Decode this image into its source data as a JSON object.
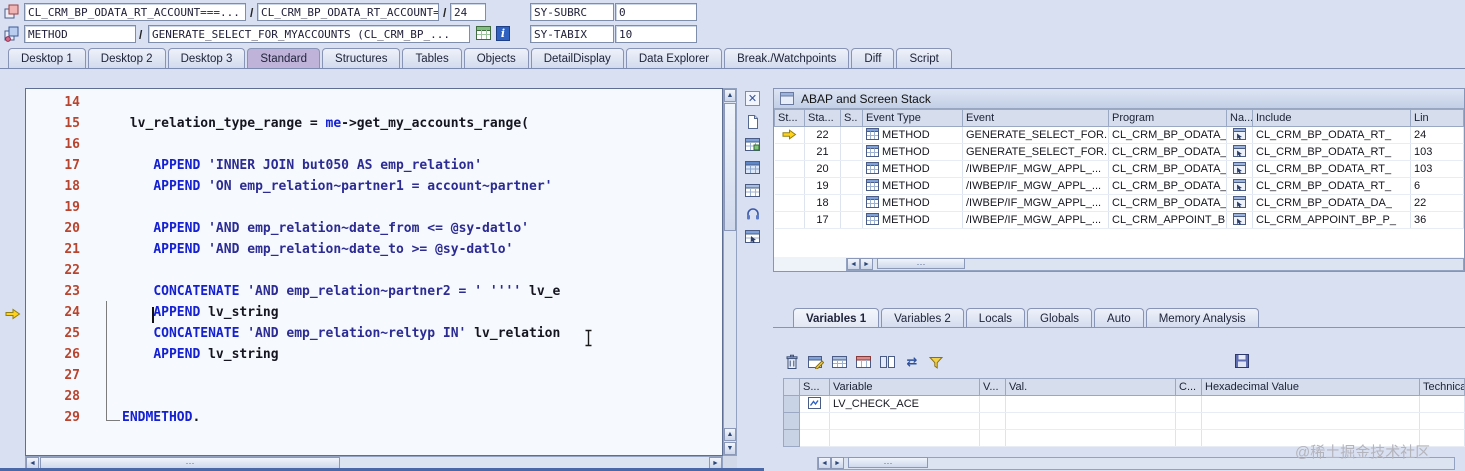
{
  "topbar": {
    "row1": {
      "class_field_1": "CL_CRM_BP_ODATA_RT_ACCOUNT===...",
      "separator": "/",
      "class_field_2": "CL_CRM_BP_ODATA_RT_ACCOUNT===...",
      "line_field": "24",
      "sy_subrc_label": "SY-SUBRC",
      "sy_subrc_value": "0"
    },
    "row2": {
      "event_type_field": "METHOD",
      "separator": "/",
      "event_field": "GENERATE_SELECT_FOR_MYACCOUNTS (CL_CRM_BP_...",
      "sy_tabix_label": "SY-TABIX",
      "sy_tabix_value": "10"
    }
  },
  "desktop_tabs": {
    "items": [
      "Desktop 1",
      "Desktop 2",
      "Desktop 3",
      "Standard",
      "Structures",
      "Tables",
      "Objects",
      "DetailDisplay",
      "Data Explorer",
      "Break./Watchpoints",
      "Diff",
      "Script"
    ],
    "active": "Standard"
  },
  "editor": {
    "current_line": "24",
    "lines": [
      {
        "n": "14",
        "t": []
      },
      {
        "n": "15",
        "t": [
          [
            "w",
            " "
          ],
          [
            "p",
            "lv_relation_type_range = "
          ],
          [
            "k",
            "me"
          ],
          [
            "p",
            "->get_my_accounts_range("
          ]
        ]
      },
      {
        "n": "16",
        "t": []
      },
      {
        "n": "17",
        "t": [
          [
            "w",
            "    "
          ],
          [
            "k",
            "APPEND"
          ],
          [
            "p",
            " "
          ],
          [
            "s",
            "'INNER JOIN but050 AS emp_relation'"
          ]
        ]
      },
      {
        "n": "18",
        "t": [
          [
            "w",
            "    "
          ],
          [
            "k",
            "APPEND"
          ],
          [
            "p",
            " "
          ],
          [
            "s",
            "'ON emp_relation~partner1 = account~partner'"
          ]
        ]
      },
      {
        "n": "19",
        "t": []
      },
      {
        "n": "20",
        "t": [
          [
            "w",
            "    "
          ],
          [
            "k",
            "APPEND"
          ],
          [
            "p",
            " "
          ],
          [
            "s",
            "'AND emp_relation~date_from <= @sy-datlo'"
          ]
        ]
      },
      {
        "n": "21",
        "t": [
          [
            "w",
            "    "
          ],
          [
            "k",
            "APPEND"
          ],
          [
            "p",
            " "
          ],
          [
            "s",
            "'AND emp_relation~date_to >= @sy-datlo'"
          ]
        ]
      },
      {
        "n": "22",
        "t": []
      },
      {
        "n": "23",
        "t": [
          [
            "w",
            "    "
          ],
          [
            "k",
            "CONCATENATE"
          ],
          [
            "p",
            " "
          ],
          [
            "s",
            "'AND emp_relation~partner2 = '"
          ],
          [
            "p",
            " "
          ],
          [
            "s",
            "''''"
          ],
          [
            "p",
            " lv_e"
          ]
        ],
        "caret": false
      },
      {
        "n": "24",
        "t": [
          [
            "w",
            "    "
          ],
          [
            "k",
            "APPEND"
          ],
          [
            "p",
            " lv_string"
          ]
        ],
        "caret": true
      },
      {
        "n": "25",
        "t": [
          [
            "w",
            "    "
          ],
          [
            "k",
            "CONCATENATE"
          ],
          [
            "p",
            " "
          ],
          [
            "s",
            "'AND emp_relation~reltyp IN'"
          ],
          [
            "p",
            " lv_relation"
          ]
        ]
      },
      {
        "n": "26",
        "t": [
          [
            "w",
            "    "
          ],
          [
            "k",
            "APPEND"
          ],
          [
            "p",
            " lv_string"
          ]
        ]
      },
      {
        "n": "27",
        "t": []
      },
      {
        "n": "28",
        "t": []
      },
      {
        "n": "29",
        "t": [
          [
            "k",
            "ENDMETHOD"
          ],
          [
            "p",
            "."
          ]
        ]
      }
    ]
  },
  "stack": {
    "title": "ABAP and Screen Stack",
    "columns": [
      "St...",
      "Sta...",
      "S..",
      "Event Type",
      "Event",
      "Program",
      "Na...",
      "Include",
      "Lin"
    ],
    "rows": [
      {
        "active": true,
        "stack_no": "22",
        "event_type": "METHOD",
        "event": "GENERATE_SELECT_FOR...",
        "program": "CL_CRM_BP_ODATA_RT...",
        "include": "CL_CRM_BP_ODATA_RT_",
        "line": "24"
      },
      {
        "active": false,
        "stack_no": "21",
        "event_type": "METHOD",
        "event": "GENERATE_SELECT_FOR...",
        "program": "CL_CRM_BP_ODATA_RT...",
        "include": "CL_CRM_BP_ODATA_RT_",
        "line": "103"
      },
      {
        "active": false,
        "stack_no": "20",
        "event_type": "METHOD",
        "event": "/IWBEP/IF_MGW_APPL_...",
        "program": "CL_CRM_BP_ODATA_RT...",
        "include": "CL_CRM_BP_ODATA_RT_",
        "line": "103"
      },
      {
        "active": false,
        "stack_no": "19",
        "event_type": "METHOD",
        "event": "/IWBEP/IF_MGW_APPL_...",
        "program": "CL_CRM_BP_ODATA_RT...",
        "include": "CL_CRM_BP_ODATA_RT_",
        "line": "6"
      },
      {
        "active": false,
        "stack_no": "18",
        "event_type": "METHOD",
        "event": "/IWBEP/IF_MGW_APPL_...",
        "program": "CL_CRM_BP_ODATA_DA...",
        "include": "CL_CRM_BP_ODATA_DA_",
        "line": "22"
      },
      {
        "active": false,
        "stack_no": "17",
        "event_type": "METHOD",
        "event": "/IWBEP/IF_MGW_APPL_...",
        "program": "CL_CRM_APPOINT_BP_P...",
        "include": "CL_CRM_APPOINT_BP_P_",
        "line": "36"
      }
    ]
  },
  "variables": {
    "tabs": [
      "Variables 1",
      "Variables 2",
      "Locals",
      "Globals",
      "Auto",
      "Memory Analysis"
    ],
    "active_tab": "Variables 1",
    "columns": [
      "S...",
      "Variable",
      "V...",
      "Val.",
      "C...",
      "Hexadecimal Value",
      "Technical Type"
    ],
    "rows": [
      {
        "variable": "LV_CHECK_ACE",
        "val": "",
        "hex": "",
        "type": ""
      },
      {
        "variable": "",
        "val": "",
        "hex": "",
        "type": ""
      },
      {
        "variable": "",
        "val": "",
        "hex": "",
        "type": ""
      }
    ]
  },
  "icons": {
    "up": "▲",
    "down": "▼",
    "left": "◄",
    "right": "►",
    "swap": "⇄",
    "grip": "⋯",
    "info": "i",
    "close": "✕"
  },
  "watermark": "@稀土掘金技术社区"
}
